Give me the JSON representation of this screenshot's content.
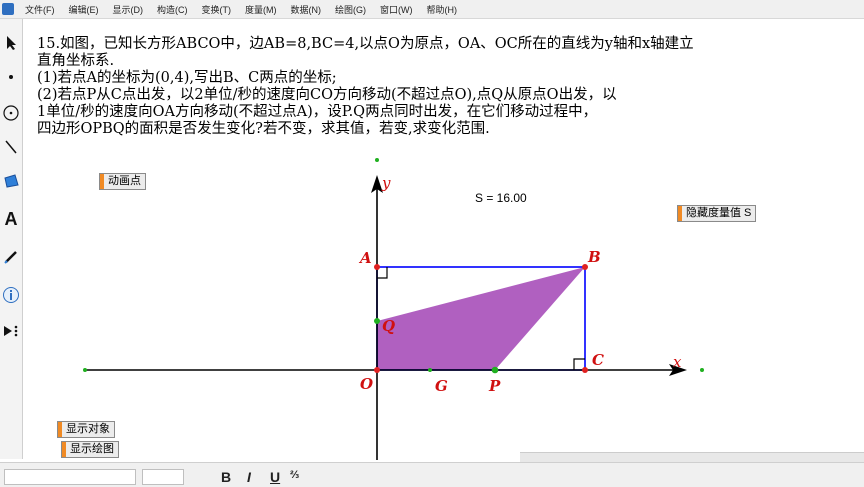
{
  "menu": [
    "文件(F)",
    "编辑(E)",
    "显示(D)",
    "构造(C)",
    "变换(T)",
    "度量(M)",
    "数据(N)",
    "绘图(G)",
    "窗口(W)",
    "帮助(H)"
  ],
  "problem": {
    "lines": [
      "15.如图，已知长方形ABCO中，边AB=8,BC=4,以点O为原点，OA、OC所在的直线为y轴和x轴建立",
      "直角坐标系.",
      "(1)若点A的坐标为(0,4),写出B、C两点的坐标;",
      "(2)若点P从C点出发，以2单位/秒的速度向CO方向移动(不超过点O),点Q从原点O出发，以",
      "1单位/秒的速度向OA方向移动(不超过点A)，设P.Q两点同时出发，在它们移动过程中，",
      "四边形OPBQ的面积是否发生变化?若不变，求其值，若变,求变化范围."
    ]
  },
  "buttons": {
    "animate": "动画点",
    "hide_measure": "隐藏度量值 S",
    "show_objects": "显示对象",
    "show_drawing": "显示绘图"
  },
  "measure": {
    "label": "S = 16.00"
  },
  "axes": {
    "x_label": "x",
    "y_label": "y"
  },
  "points": {
    "A": "A",
    "B": "B",
    "C": "C",
    "O": "O",
    "Q": "Q",
    "P": "P",
    "G": "G"
  },
  "colors": {
    "axis": "#000000",
    "rectangle": "#0000ff",
    "fill": "#b060c0",
    "point_red": "#e02020",
    "point_green": "#20b020",
    "label_red": "#d01010",
    "button_accent": "#f08a24"
  },
  "format_bar": {
    "bold": "B",
    "italic": "I",
    "underline": "U"
  }
}
